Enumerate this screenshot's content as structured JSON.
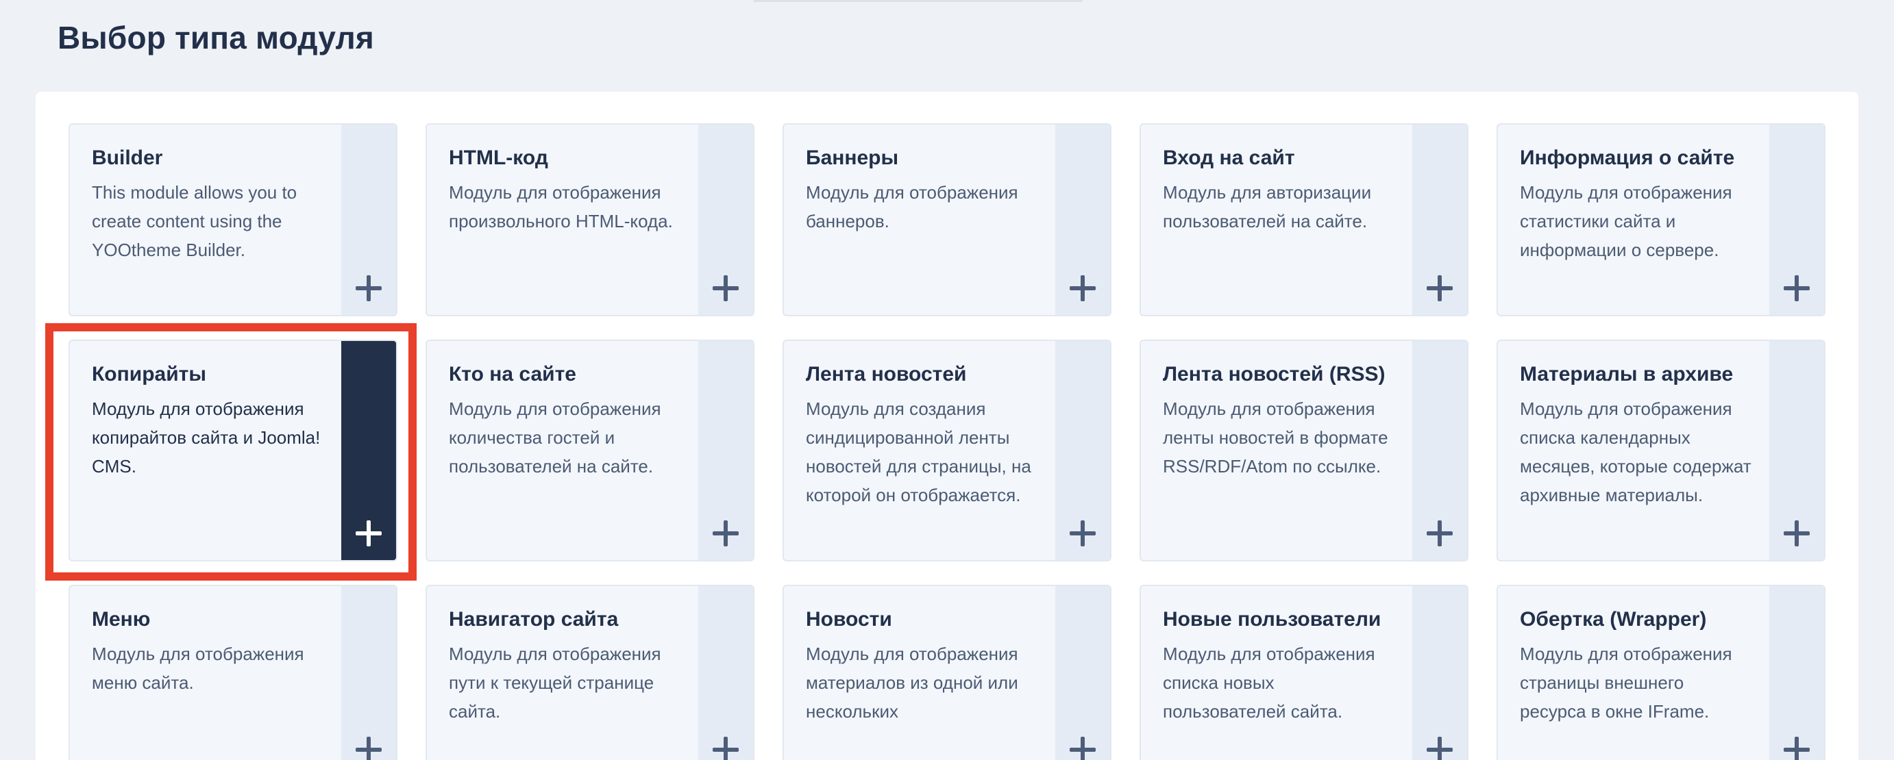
{
  "page": {
    "title": "Выбор типа модуля"
  },
  "colors": {
    "highlight": "#e8402a",
    "active_side": "#22304a",
    "side": "#e4ebf5"
  },
  "modules": [
    {
      "title": "Builder",
      "description": "This module allows you to create content using the YOOtheme Builder.",
      "active": false
    },
    {
      "title": "HTML-код",
      "description": "Модуль для отображения произвольного HTML-кода.",
      "active": false
    },
    {
      "title": "Баннеры",
      "description": "Модуль для отображения баннеров.",
      "active": false
    },
    {
      "title": "Вход на сайт",
      "description": "Модуль для авторизации пользователей на сайте.",
      "active": false
    },
    {
      "title": "Информация о сайте",
      "description": "Модуль для отображения статистики сайта и информации о сервере.",
      "active": false
    },
    {
      "title": "Копирайты",
      "description": "Модуль для отображения копирайтов сайта и Joomla! CMS.",
      "active": true
    },
    {
      "title": "Кто на сайте",
      "description": "Модуль для отображения количества гостей и пользователей на сайте.",
      "active": false
    },
    {
      "title": "Лента новостей",
      "description": "Модуль для создания синдицированной ленты новостей для страницы, на которой он отображается.",
      "active": false
    },
    {
      "title": "Лента новостей (RSS)",
      "description": "Модуль для отображения ленты новостей в формате RSS/RDF/Atom по ссылке.",
      "active": false
    },
    {
      "title": "Материалы в архиве",
      "description": "Модуль для отображения списка календарных месяцев, которые содержат архивные материалы.",
      "active": false
    },
    {
      "title": "Меню",
      "description": "Модуль для отображения меню сайта.",
      "active": false
    },
    {
      "title": "Навигатор сайта",
      "description": "Модуль для отображения пути к текущей странице сайта.",
      "active": false
    },
    {
      "title": "Новости",
      "description": "Модуль для отображения материалов из одной или нескольких",
      "active": false
    },
    {
      "title": "Новые пользователи",
      "description": "Модуль для отображения списка новых пользователей сайта.",
      "active": false
    },
    {
      "title": "Обертка (Wrapper)",
      "description": "Модуль для отображения страницы внешнего ресурса в окне IFrame.",
      "active": false
    }
  ]
}
